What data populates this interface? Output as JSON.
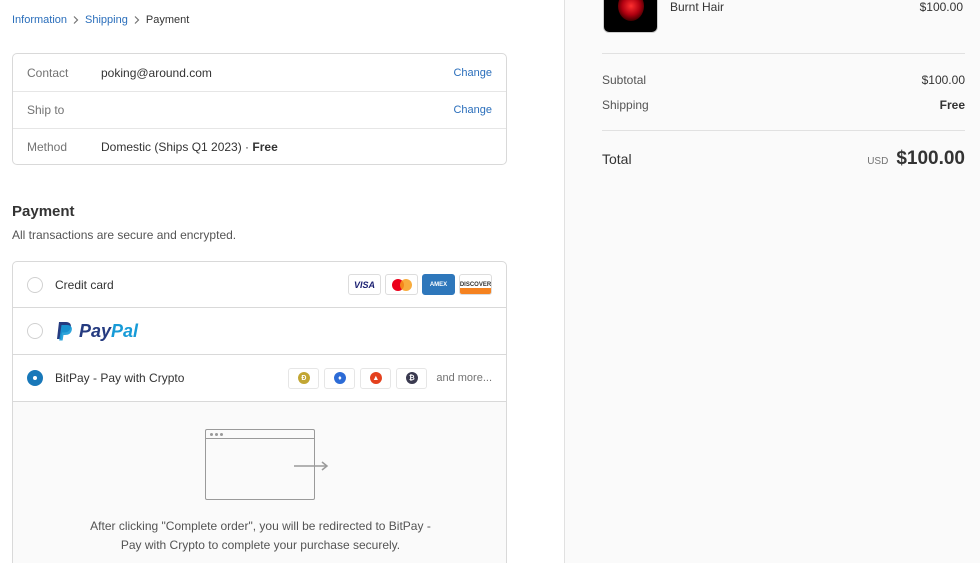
{
  "breadcrumb": {
    "items": [
      {
        "label": "Information"
      },
      {
        "label": "Shipping"
      },
      {
        "label": "Payment"
      }
    ]
  },
  "review": {
    "rows": [
      {
        "label": "Contact",
        "value": "poking@around.com",
        "change": "Change"
      },
      {
        "label": "Ship to",
        "value": "",
        "change": "Change"
      },
      {
        "label": "Method",
        "value": "Domestic (Ships Q1 2023) · ",
        "value_bold": "Free"
      }
    ]
  },
  "payment": {
    "title": "Payment",
    "subtitle": "All transactions are secure and encrypted.",
    "options": [
      {
        "label": "Credit card",
        "selected": false,
        "cards": [
          "VISA",
          "mastercard",
          "AMEX",
          "DISCOVER"
        ]
      },
      {
        "label": "PayPal",
        "selected": false
      },
      {
        "label": "BitPay - Pay with Crypto",
        "selected": true,
        "more": "and more..."
      }
    ],
    "redirect_text_1": "After clicking \"Complete order\", you will be redirected to BitPay -",
    "redirect_text_2": "Pay with Crypto to complete your purchase securely."
  },
  "summary": {
    "product": {
      "name": "Burnt Hair",
      "price": "$100.00"
    },
    "subtotal_label": "Subtotal",
    "subtotal_value": "$100.00",
    "shipping_label": "Shipping",
    "shipping_value": "Free",
    "total_label": "Total",
    "total_currency": "USD",
    "total_value": "$100.00"
  },
  "colors": {
    "link": "#2a6ebb",
    "radio_selected": "#1878b9",
    "paypal_dark": "#253b80",
    "paypal_light": "#179bd7"
  }
}
